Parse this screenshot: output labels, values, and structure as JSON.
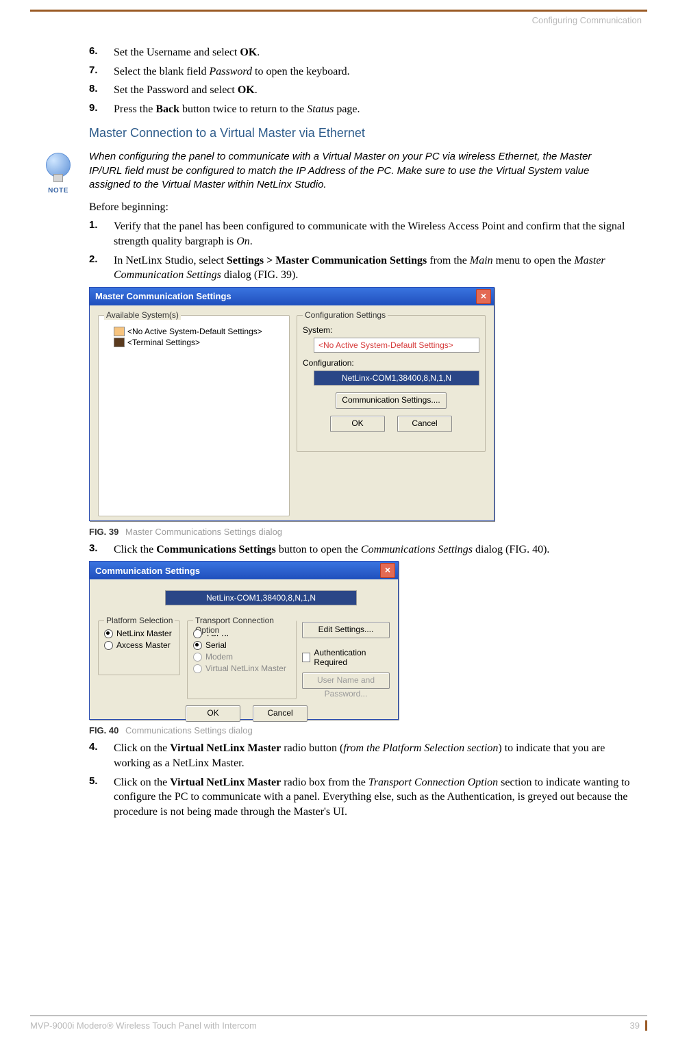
{
  "header": {
    "section": "Configuring Communication"
  },
  "steps_before": [
    {
      "num": "6.",
      "html": "Set the Username and select <b>OK</b>."
    },
    {
      "num": "7.",
      "html": "Select the blank field <i>Password</i> to open the keyboard."
    },
    {
      "num": "8.",
      "html": "Set the Password and select <b>OK</b>."
    },
    {
      "num": "9.",
      "html": "Press the <b>Back</b> button twice to return to the <i>Status</i> page."
    }
  ],
  "h2": "Master Connection to a Virtual Master via Ethernet",
  "note": {
    "label": "NOTE",
    "text": "When configuring the panel to communicate with a Virtual Master on your PC via wireless Ethernet, the Master IP/URL field must be configured to match the IP Address of the PC. Make sure to use the Virtual System value assigned to the Virtual Master within NetLinx Studio."
  },
  "before_text": "Before beginning:",
  "steps_a": [
    {
      "num": "1.",
      "html": "Verify that the panel has been configured to communicate with the Wireless Access Point and confirm that the signal strength quality bargraph is <i>On</i>."
    },
    {
      "num": "2.",
      "html": "In NetLinx Studio, select <b>Settings &gt; Master Communication Settings</b> from the <i>Main</i> menu to open the <i>Master Communication Settings</i> dialog (FIG. 39)."
    }
  ],
  "dialog1": {
    "title": "Master Communication Settings",
    "group_avail": "Available System(s)",
    "tree_item1": "<No Active System-Default Settings>",
    "tree_item2": "<Terminal Settings>",
    "group_conf": "Configuration Settings",
    "system_label": "System:",
    "system_value": "<No Active System-Default Settings>",
    "config_label": "Configuration:",
    "config_value": "NetLinx-COM1,38400,8,N,1,N",
    "comm_btn": "Communication Settings....",
    "ok": "OK",
    "cancel": "Cancel"
  },
  "fig39": {
    "label": "FIG. 39",
    "text": "Master Communications Settings dialog"
  },
  "steps_b": [
    {
      "num": "3.",
      "html": "Click the <b>Communications Settings</b> button to open the <i>Communications Settings</i> dialog (FIG. 40)."
    }
  ],
  "dialog2": {
    "title": "Communication Settings",
    "config_value": "NetLinx-COM1,38400,8,N,1,N",
    "group_plat": "Platform Selection",
    "radio_netlinx": "NetLinx Master",
    "radio_axcess": "Axcess Master",
    "group_trans": "Transport Connection Option",
    "radio_tcpip": "TCP/IP",
    "radio_serial": "Serial",
    "radio_modem": "Modem",
    "radio_vnm": "Virtual NetLinx Master",
    "edit_btn": "Edit Settings....",
    "auth_label": "Authentication Required",
    "user_btn": "User Name and Password...",
    "ok": "OK",
    "cancel": "Cancel"
  },
  "fig40": {
    "label": "FIG. 40",
    "text": "Communications Settings dialog"
  },
  "steps_c": [
    {
      "num": "4.",
      "html": "Click on the <b>Virtual NetLinx Master</b> radio button (<i>from the Platform Selection section</i>) to indicate that you are working as a NetLinx Master."
    },
    {
      "num": "5.",
      "html": "Click on the <b>Virtual NetLinx Master</b> radio box from the <i>Transport Connection Option</i> section to indicate wanting to configure the PC to communicate with a panel. Everything else, such as the Authentication, is greyed out because the procedure is not being made through the Master's UI."
    }
  ],
  "footer": {
    "product": "MVP-9000i Modero® Wireless Touch Panel with Intercom",
    "page": "39"
  }
}
